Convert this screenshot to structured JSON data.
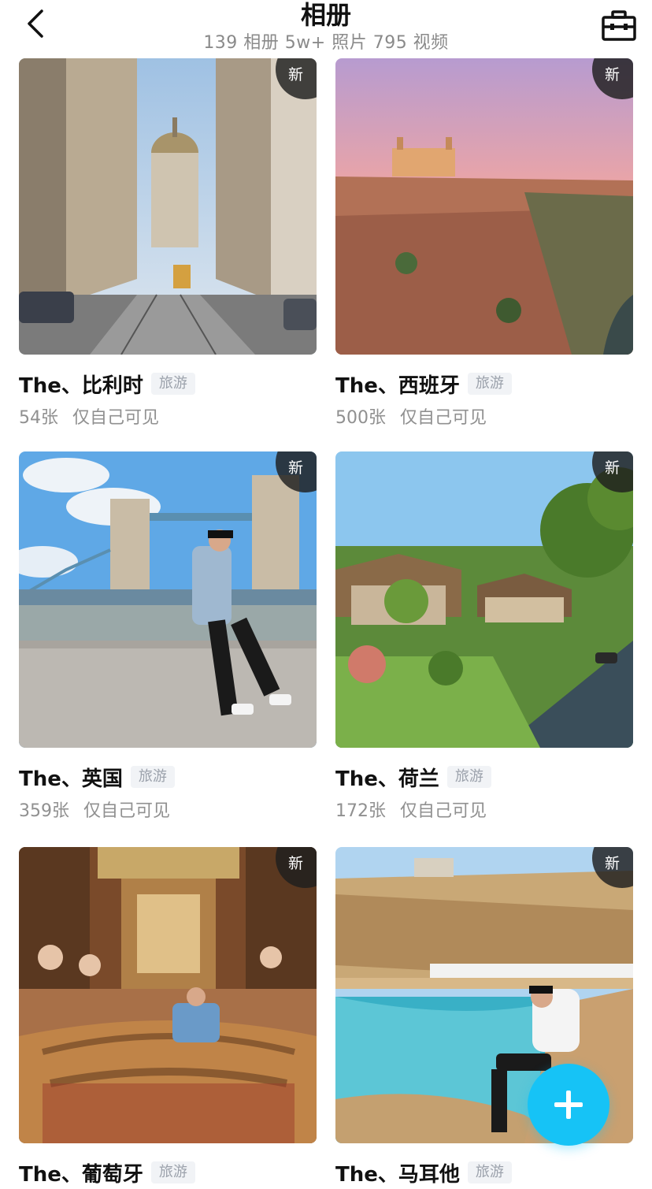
{
  "header": {
    "title": "相册",
    "subtitle": "139 相册 5w+ 照片 795 视频"
  },
  "albums": [
    {
      "name": "The、比利时",
      "tag": "旅游",
      "count": "54张",
      "privacy": "仅自己可见",
      "badge": "新"
    },
    {
      "name": "The、西班牙",
      "tag": "旅游",
      "count": "500张",
      "privacy": "仅自己可见",
      "badge": "新"
    },
    {
      "name": "The、英国",
      "tag": "旅游",
      "count": "359张",
      "privacy": "仅自己可见",
      "badge": "新"
    },
    {
      "name": "The、荷兰",
      "tag": "旅游",
      "count": "172张",
      "privacy": "仅自己可见",
      "badge": "新"
    },
    {
      "name": "The、葡萄牙",
      "tag": "旅游",
      "count": "",
      "privacy": "",
      "badge": "新"
    },
    {
      "name": "The、马耳他",
      "tag": "旅游",
      "count": "",
      "privacy": "",
      "badge": "新"
    }
  ],
  "icons": {
    "back": "chevron-left-icon",
    "toolbox": "toolbox-icon",
    "add": "plus-icon"
  },
  "colors": {
    "accent": "#16c3f6",
    "tag_bg": "#f1f3f6",
    "tag_text": "#9ba1ab",
    "meta_text": "#909090"
  }
}
